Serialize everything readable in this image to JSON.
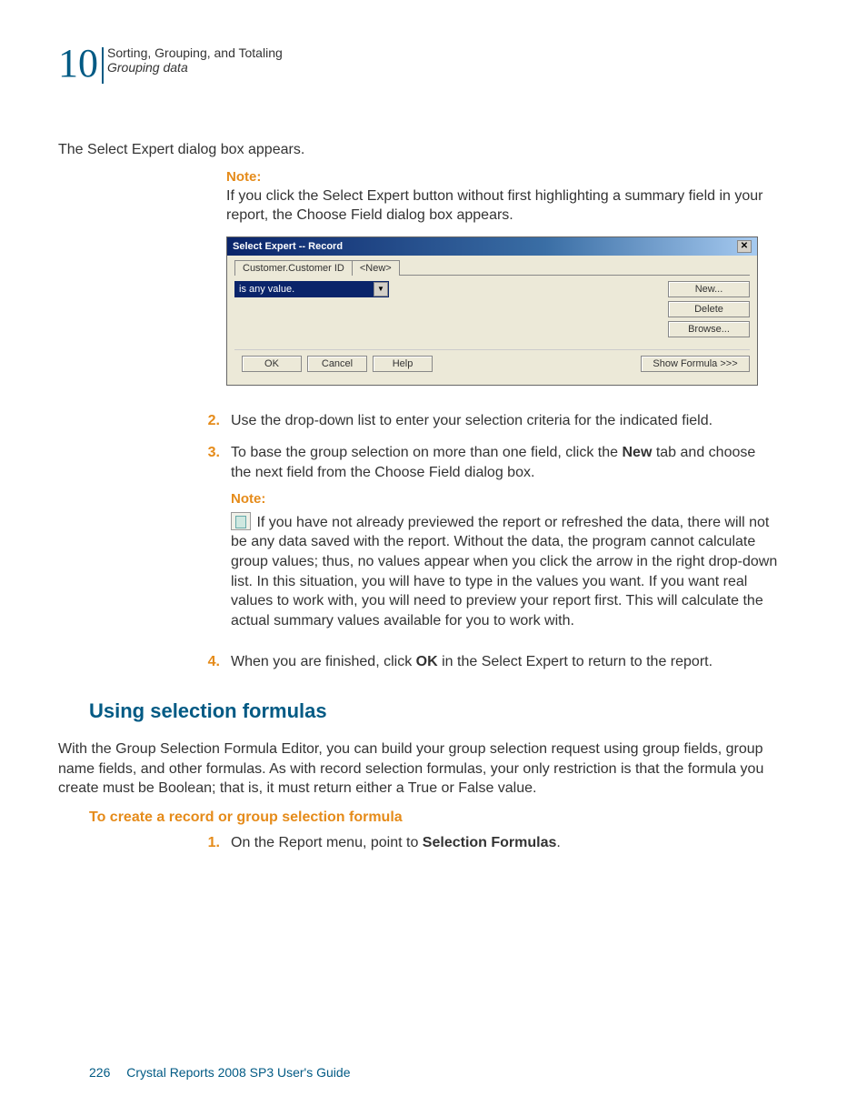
{
  "header": {
    "chapter_number": "10",
    "chapter_title": "Sorting, Grouping, and Totaling",
    "chapter_subtitle": "Grouping data"
  },
  "intro_paragraph": "The Select Expert dialog box appears.",
  "note1": {
    "label": "Note:",
    "text": "If you click the Select Expert button without first highlighting a summary field in your report, the Choose Field dialog box appears."
  },
  "dialog": {
    "title": "Select Expert -- Record",
    "tab_active": "Customer.Customer ID",
    "tab_new": "<New>",
    "criteria_value": "is any value.",
    "buttons": {
      "new": "New...",
      "delete": "Delete",
      "browse": "Browse...",
      "ok": "OK",
      "cancel": "Cancel",
      "help": "Help",
      "show_formula": "Show Formula >>>"
    }
  },
  "steps_a": [
    {
      "num": "2.",
      "text": "Use the drop-down list to enter your selection criteria for the indicated field."
    },
    {
      "num": "3.",
      "text_before": "To base the group selection on more than one field, click the ",
      "bold": "New",
      "text_after": " tab and choose the next field from the Choose Field dialog box."
    }
  ],
  "note2": {
    "label": "Note:",
    "text": " If you have not already previewed the report or refreshed the data, there will not be any data saved with the report. Without the data, the program cannot calculate group values; thus, no values appear when you click the arrow in the right drop-down list. In this situation, you will have to type in the values you want. If you want real values to work with, you will need to preview your report first. This will calculate the actual summary values available for you to work with."
  },
  "steps_b": [
    {
      "num": "4.",
      "text_before": "When you are finished, click ",
      "bold": "OK",
      "text_after": " in the Select Expert to return to the report."
    }
  ],
  "section_heading": "Using selection formulas",
  "section_body": "With the Group Selection Formula Editor, you can build your group selection request using group fields, group name fields, and other formulas. As with record selection formulas, your only restriction is that the formula you create must be Boolean; that is, it must return either a True or False value.",
  "sub_heading": "To create a record or group selection formula",
  "steps_c": [
    {
      "num": "1.",
      "text_before": "On the Report menu, point to ",
      "bold": "Selection Formulas",
      "text_after": "."
    }
  ],
  "footer": {
    "page_number": "226",
    "doc_title": "Crystal Reports 2008 SP3 User's Guide"
  }
}
